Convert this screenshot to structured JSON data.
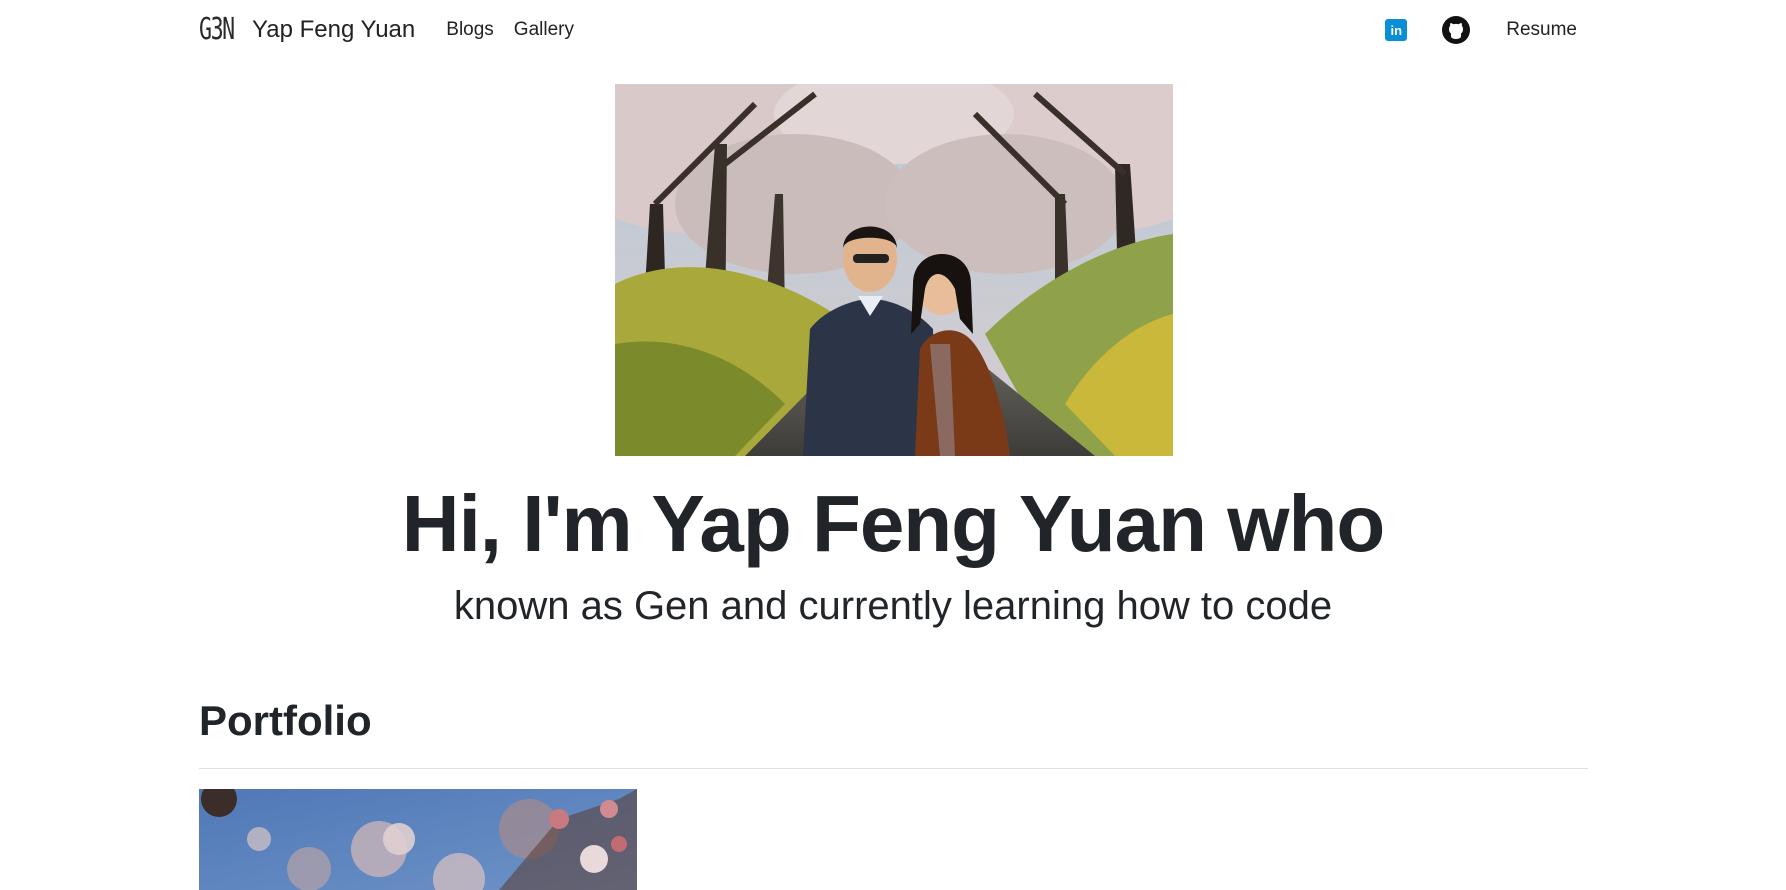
{
  "navbar": {
    "logo_text": "G3N",
    "brand_name": "Yap Feng Yuan",
    "links": [
      {
        "label": "Blogs"
      },
      {
        "label": "Gallery"
      }
    ],
    "social": [
      {
        "icon": "linkedin-icon",
        "glyph": "in",
        "color": "#0a8fd6"
      },
      {
        "icon": "github-icon",
        "color": "#111111"
      }
    ],
    "resume_label": "Resume"
  },
  "hero": {
    "photo_icon": "cherry-blossom-couple-photo",
    "title": "Hi, I'm Yap Feng Yuan who",
    "subtitle": "known as Gen and currently learning how to code"
  },
  "portfolio": {
    "heading": "Portfolio",
    "cards": [
      {
        "image": "cherry-blossom-closeup-image"
      }
    ]
  }
}
